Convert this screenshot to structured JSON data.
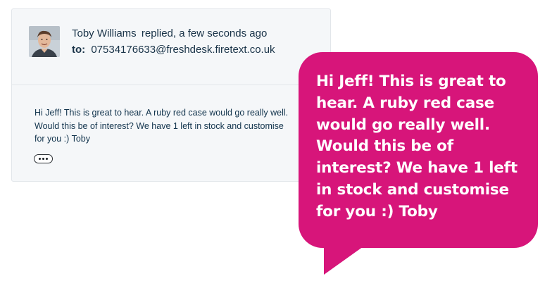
{
  "reply": {
    "sender_name": "Toby Williams",
    "meta": "replied, a few seconds ago",
    "to_label": "to:",
    "to_address": "07534176633@freshdesk.firetext.co.uk",
    "body": "Hi Jeff! This is great to hear. A ruby red case would go really well.\nWould this be of interest? We have 1 left in stock and customise\nfor you :) Toby",
    "more_icon": "ellipsis-icon"
  },
  "callout": {
    "text": "Hi Jeff! This is great to\nhear. A ruby red case\nwould go really well.\nWould this be of\ninterest? We have 1 left\nin stock and customise\nfor you :) Toby",
    "color": "#d7157a"
  }
}
